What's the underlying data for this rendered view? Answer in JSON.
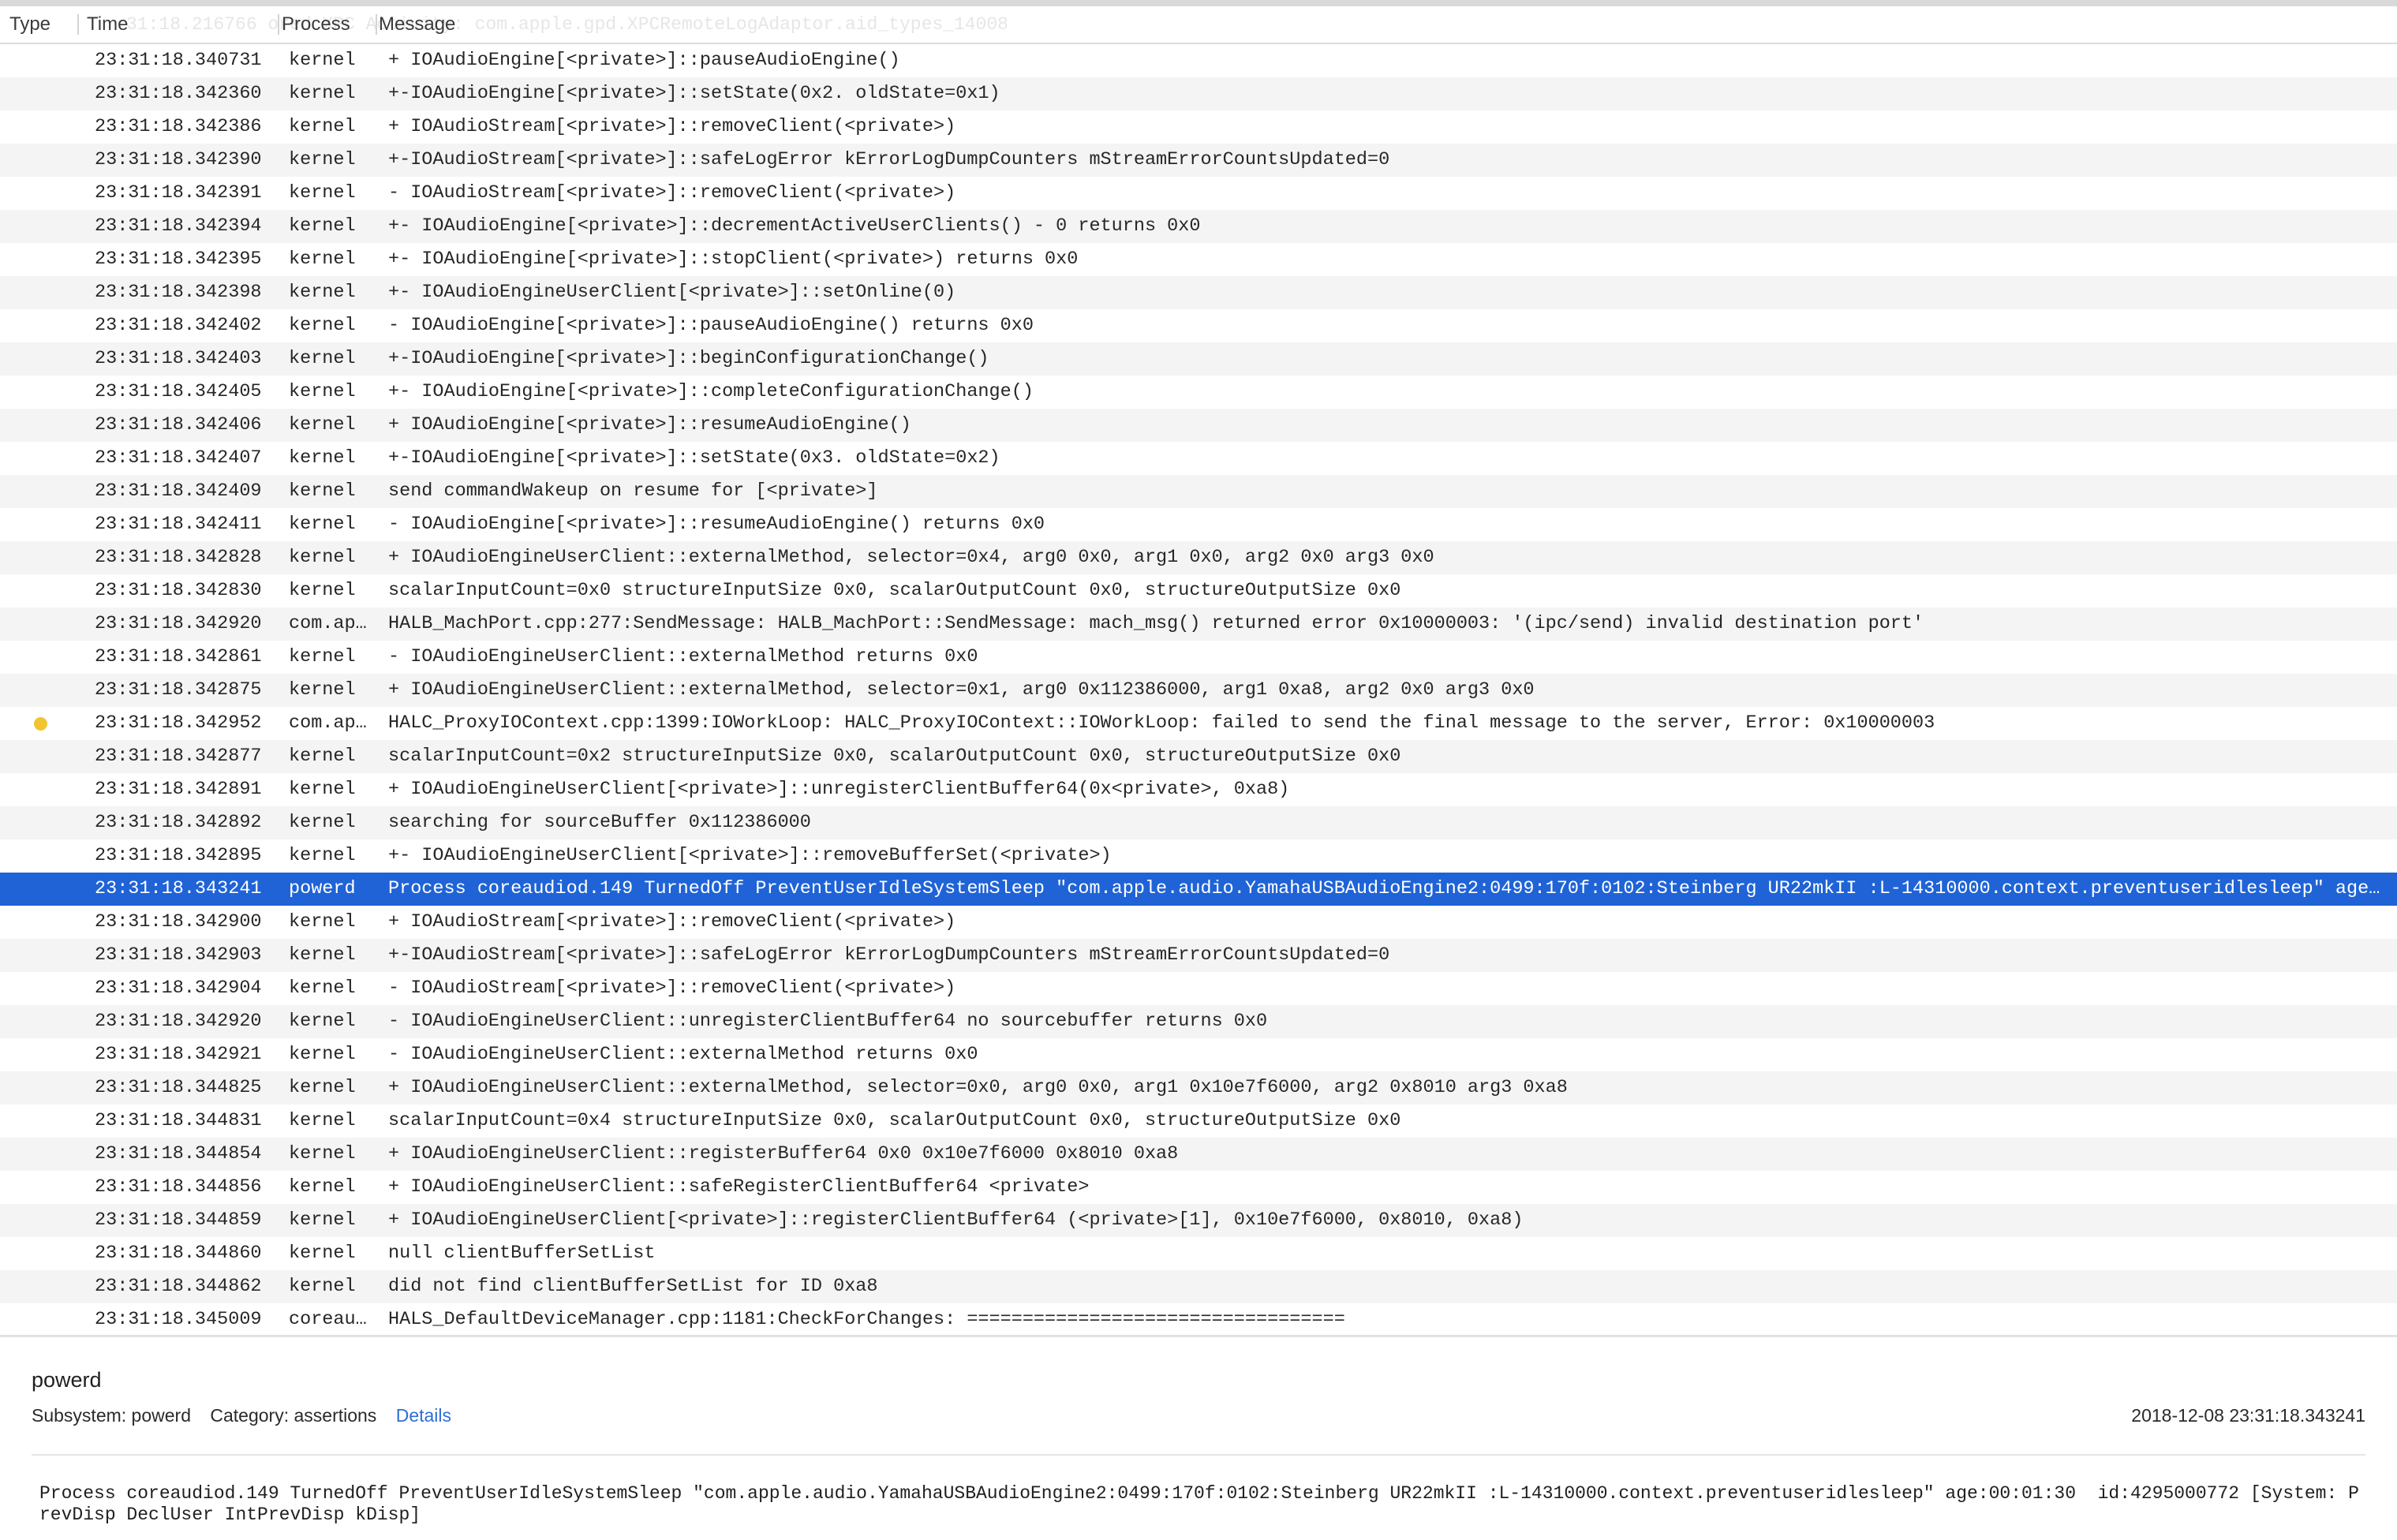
{
  "columns": {
    "type": "Type",
    "time": "Time",
    "process": "Process",
    "message": "Message"
  },
  "ghost_text": "31:18.216766  ored XPC Activity: com.apple.gpd.XPCRemoteLogAdaptor.aid_types_14008",
  "rows": [
    {
      "time": "23:31:18.340731",
      "process": "kernel",
      "message": "+ IOAudioEngine[<private>]::pauseAudioEngine()"
    },
    {
      "time": "23:31:18.342360",
      "process": "kernel",
      "message": "+-IOAudioEngine[<private>]::setState(0x2. oldState=0x1)"
    },
    {
      "time": "23:31:18.342386",
      "process": "kernel",
      "message": "+ IOAudioStream[<private>]::removeClient(<private>)"
    },
    {
      "time": "23:31:18.342390",
      "process": "kernel",
      "message": "+-IOAudioStream[<private>]::safeLogError kErrorLogDumpCounters mStreamErrorCountsUpdated=0"
    },
    {
      "time": "23:31:18.342391",
      "process": "kernel",
      "message": "- IOAudioStream[<private>]::removeClient(<private>)"
    },
    {
      "time": "23:31:18.342394",
      "process": "kernel",
      "message": "+- IOAudioEngine[<private>]::decrementActiveUserClients() - 0 returns 0x0"
    },
    {
      "time": "23:31:18.342395",
      "process": "kernel",
      "message": "+- IOAudioEngine[<private>]::stopClient(<private>) returns 0x0"
    },
    {
      "time": "23:31:18.342398",
      "process": "kernel",
      "message": "+- IOAudioEngineUserClient[<private>]::setOnline(0)"
    },
    {
      "time": "23:31:18.342402",
      "process": "kernel",
      "message": "- IOAudioEngine[<private>]::pauseAudioEngine() returns 0x0"
    },
    {
      "time": "23:31:18.342403",
      "process": "kernel",
      "message": "+-IOAudioEngine[<private>]::beginConfigurationChange()"
    },
    {
      "time": "23:31:18.342405",
      "process": "kernel",
      "message": "+- IOAudioEngine[<private>]::completeConfigurationChange()"
    },
    {
      "time": "23:31:18.342406",
      "process": "kernel",
      "message": "+ IOAudioEngine[<private>]::resumeAudioEngine()"
    },
    {
      "time": "23:31:18.342407",
      "process": "kernel",
      "message": "+-IOAudioEngine[<private>]::setState(0x3. oldState=0x2)"
    },
    {
      "time": "23:31:18.342409",
      "process": "kernel",
      "message": "send commandWakeup on resume for [<private>]"
    },
    {
      "time": "23:31:18.342411",
      "process": "kernel",
      "message": "- IOAudioEngine[<private>]::resumeAudioEngine() returns 0x0"
    },
    {
      "time": "23:31:18.342828",
      "process": "kernel",
      "message": "+ IOAudioEngineUserClient::externalMethod, selector=0x4,   arg0 0x0, arg1 0x0, arg2 0x0 arg3 0x0"
    },
    {
      "time": "23:31:18.342830",
      "process": "kernel",
      "message": "  scalarInputCount=0x0  structureInputSize 0x0, scalarOutputCount 0x0, structureOutputSize 0x0"
    },
    {
      "time": "23:31:18.342920",
      "process": "com.ap…",
      "message": "HALB_MachPort.cpp:277:SendMessage:  HALB_MachPort::SendMessage: mach_msg() returned error 0x10000003: '(ipc/send) invalid destination port'"
    },
    {
      "time": "23:31:18.342861",
      "process": "kernel",
      "message": "- IOAudioEngineUserClient::externalMethod returns 0x0"
    },
    {
      "time": "23:31:18.342875",
      "process": "kernel",
      "message": "+ IOAudioEngineUserClient::externalMethod, selector=0x1,   arg0 0x112386000, arg1 0xa8, arg2 0x0 arg3 0x0"
    },
    {
      "time": "23:31:18.342952",
      "process": "com.ap…",
      "message": "HALC_ProxyIOContext.cpp:1399:IOWorkLoop:  HALC_ProxyIOContext::IOWorkLoop: failed to send the final message to the server, Error: 0x10000003",
      "type": "error"
    },
    {
      "time": "23:31:18.342877",
      "process": "kernel",
      "message": "  scalarInputCount=0x2  structureInputSize 0x0, scalarOutputCount 0x0, structureOutputSize 0x0"
    },
    {
      "time": "23:31:18.342891",
      "process": "kernel",
      "message": "+ IOAudioEngineUserClient[<private>]::unregisterClientBuffer64(0x<private>, 0xa8)"
    },
    {
      "time": "23:31:18.342892",
      "process": "kernel",
      "message": "  searching for sourceBuffer 0x112386000"
    },
    {
      "time": "23:31:18.342895",
      "process": "kernel",
      "message": "+- IOAudioEngineUserClient[<private>]::removeBufferSet(<private>)"
    },
    {
      "time": "23:31:18.343241",
      "process": "powerd",
      "message": "Process coreaudiod.149 TurnedOff PreventUserIdleSystemSleep \"com.apple.audio.YamahaUSBAudioEngine2:0499:170f:0102:Steinberg UR22mkII :L-14310000.context.preventuseridlesleep\" age:00:01:30  id:4295000772 [System: PrevDisp DeclUser IntPrevDisp kDisp]",
      "selected": true
    },
    {
      "time": "23:31:18.342900",
      "process": "kernel",
      "message": "+ IOAudioStream[<private>]::removeClient(<private>)"
    },
    {
      "time": "23:31:18.342903",
      "process": "kernel",
      "message": "+-IOAudioStream[<private>]::safeLogError kErrorLogDumpCounters mStreamErrorCountsUpdated=0"
    },
    {
      "time": "23:31:18.342904",
      "process": "kernel",
      "message": "- IOAudioStream[<private>]::removeClient(<private>)"
    },
    {
      "time": "23:31:18.342920",
      "process": "kernel",
      "message": "- IOAudioEngineUserClient::unregisterClientBuffer64 no sourcebuffer returns 0x0"
    },
    {
      "time": "23:31:18.342921",
      "process": "kernel",
      "message": "- IOAudioEngineUserClient::externalMethod returns 0x0"
    },
    {
      "time": "23:31:18.344825",
      "process": "kernel",
      "message": "+ IOAudioEngineUserClient::externalMethod, selector=0x0,   arg0 0x0, arg1 0x10e7f6000, arg2 0x8010 arg3 0xa8"
    },
    {
      "time": "23:31:18.344831",
      "process": "kernel",
      "message": "  scalarInputCount=0x4  structureInputSize 0x0, scalarOutputCount 0x0, structureOutputSize 0x0"
    },
    {
      "time": "23:31:18.344854",
      "process": "kernel",
      "message": "+ IOAudioEngineUserClient::registerBuffer64 0x0 0x10e7f6000 0x8010 0xa8"
    },
    {
      "time": "23:31:18.344856",
      "process": "kernel",
      "message": "+ IOAudioEngineUserClient::safeRegisterClientBuffer64 <private>"
    },
    {
      "time": "23:31:18.344859",
      "process": "kernel",
      "message": "+ IOAudioEngineUserClient[<private>]::registerClientBuffer64  (<private>[1], 0x10e7f6000, 0x8010, 0xa8)"
    },
    {
      "time": "23:31:18.344860",
      "process": "kernel",
      "message": "  null clientBufferSetList"
    },
    {
      "time": "23:31:18.344862",
      "process": "kernel",
      "message": "  did not find clientBufferSetList for ID 0xa8"
    },
    {
      "time": "23:31:18.345009",
      "process": "coreau…",
      "message": "HALS_DefaultDeviceManager.cpp:1181:CheckForChanges:  =================================="
    }
  ],
  "detail": {
    "process": "powerd",
    "subsystem": "Subsystem: powerd",
    "category": "Category: assertions",
    "details_link": "Details",
    "timestamp": "2018-12-08 23:31:18.343241",
    "message": "Process coreaudiod.149 TurnedOff PreventUserIdleSystemSleep \"com.apple.audio.YamahaUSBAudioEngine2:0499:170f:0102:Steinberg UR22mkII :L-14310000.context.preventuseridlesleep\" age:00:01:30  id:4295000772 [System: PrevDisp DeclUser IntPrevDisp kDisp]"
  },
  "colors": {
    "selected": "#1f63d6",
    "error_dot": "#f2c432",
    "link": "#2f6fd6"
  }
}
